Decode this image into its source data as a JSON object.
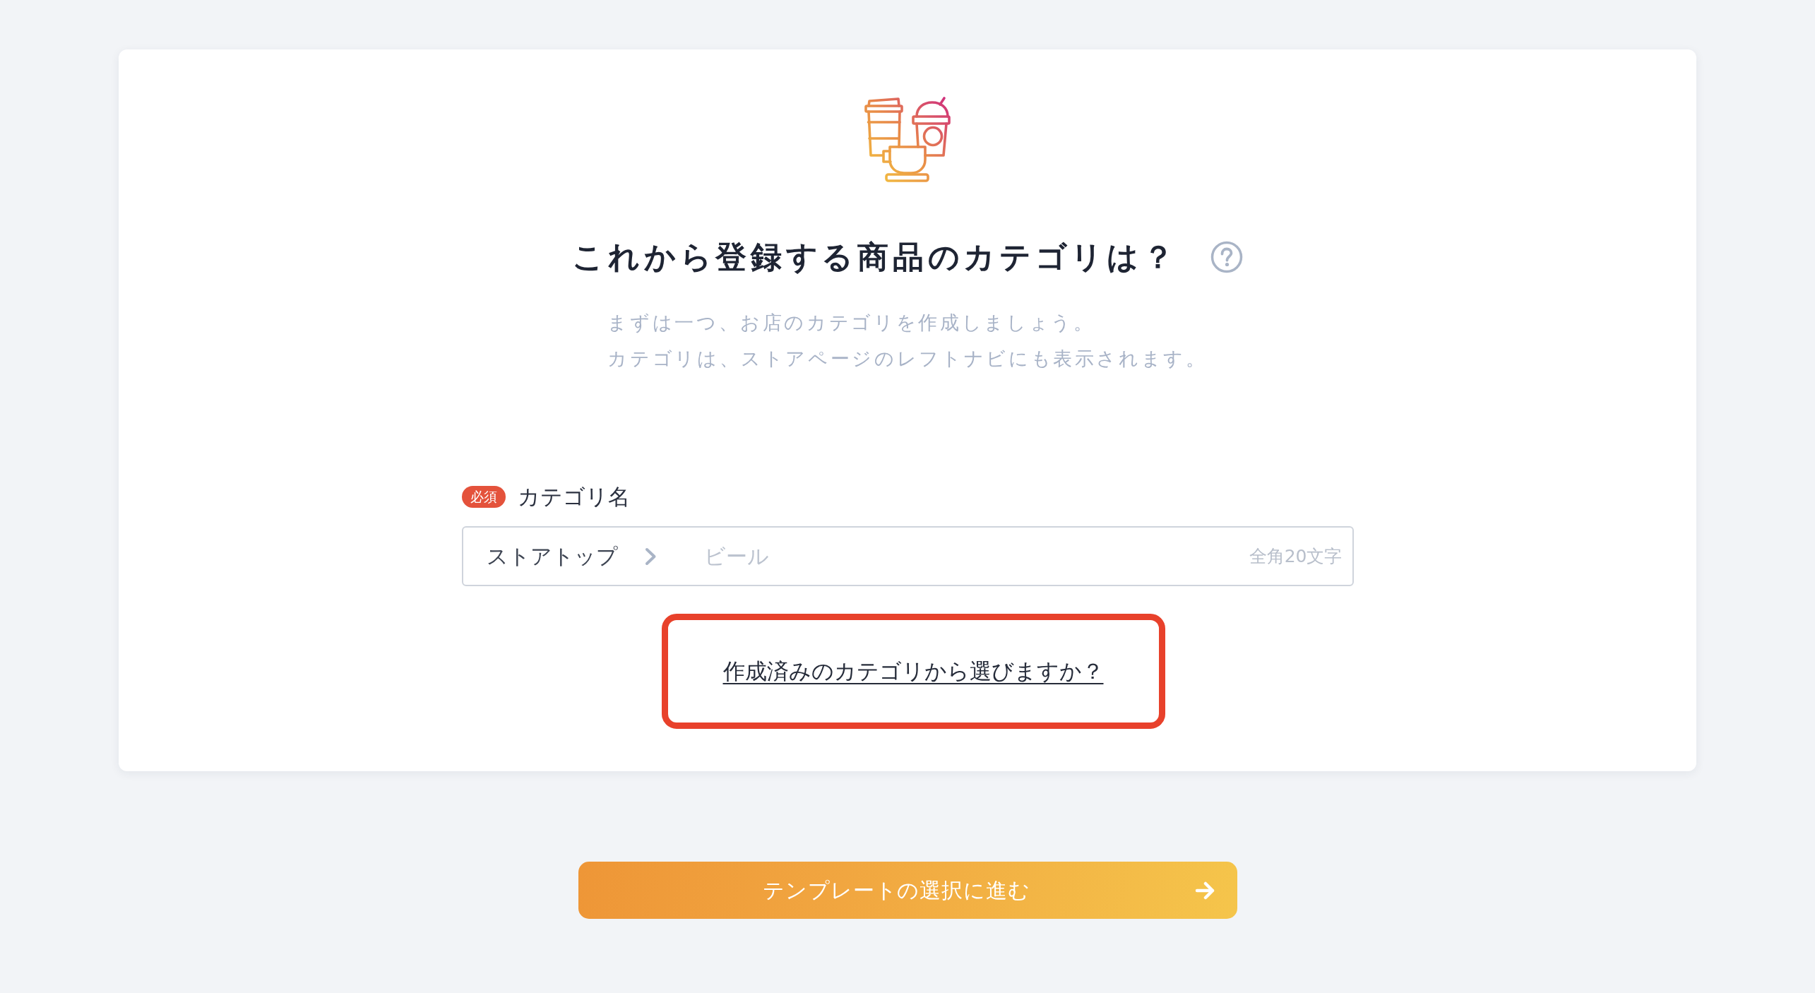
{
  "header": {
    "title": "これから登録する商品のカテゴリは？"
  },
  "description": [
    "まずは一つ、お店のカテゴリを作成しましょう。",
    "カテゴリは、ストアページのレフトナビにも表示されます。"
  ],
  "category_field": {
    "required_badge": "必須",
    "label": "カテゴリ名",
    "path_prefix": "ストアトップ",
    "placeholder": "ビール",
    "limit_note": "全角20文字"
  },
  "existing_category_link": {
    "text": "作成済みのカテゴリから選びますか？",
    "highlighted": true
  },
  "next_button": {
    "label": "テンプレートの選択に進む"
  }
}
